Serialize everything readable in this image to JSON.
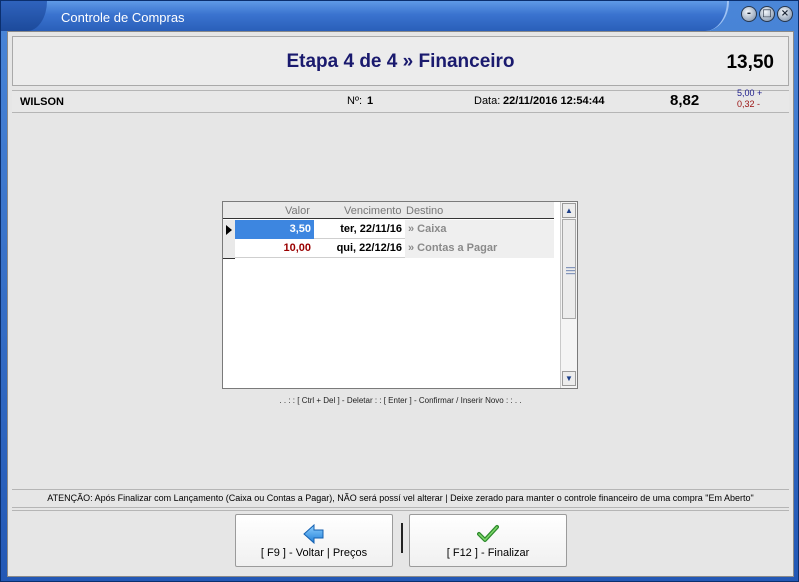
{
  "window": {
    "title": "Controle de Compras",
    "buttons": {
      "minimize": "-",
      "maximize": "□",
      "close": "×"
    }
  },
  "header": {
    "stage_title": "Etapa 4 de 4 » Financeiro",
    "total": "13,50"
  },
  "info": {
    "supplier": "WILSON",
    "numero_label": "Nº:",
    "numero_value": "1",
    "data_label": "Data:",
    "data_value": "22/11/2016 12:54:44",
    "balance": "8,82",
    "plus": "5,00 +",
    "minus": "0,32 -"
  },
  "grid": {
    "columns": [
      "Valor",
      "Vencimento",
      "Destino"
    ],
    "rows": [
      {
        "valor": "3,50",
        "vencimento": "ter, 22/11/16",
        "destino": "» Caixa"
      },
      {
        "valor": "10,00",
        "vencimento": "qui, 22/12/16",
        "destino": "» Contas a Pagar"
      }
    ]
  },
  "shortcuts": ". . : :   [ Ctrl + Del ] - Deletar   : :   [ Enter ] - Confirmar / Inserir Novo   : : . .",
  "warning": "ATENÇÃO: Após Finalizar com Lançamento (Caixa ou Contas a Pagar), NÃO será possí vel alterar | Deixe zerado para manter o controle financeiro de uma compra \"Em Aberto\"",
  "footer": {
    "back_label": "[ F9 ] - Voltar | Preços",
    "finish_label": "[ F12 ] - Finalizar"
  },
  "icons": {
    "back": "arrow-left-icon",
    "finish": "check-icon"
  },
  "colors": {
    "title_blue": "#1a1a6e",
    "selected_cell": "#3d86e0",
    "negative_red": "#9a0000"
  }
}
